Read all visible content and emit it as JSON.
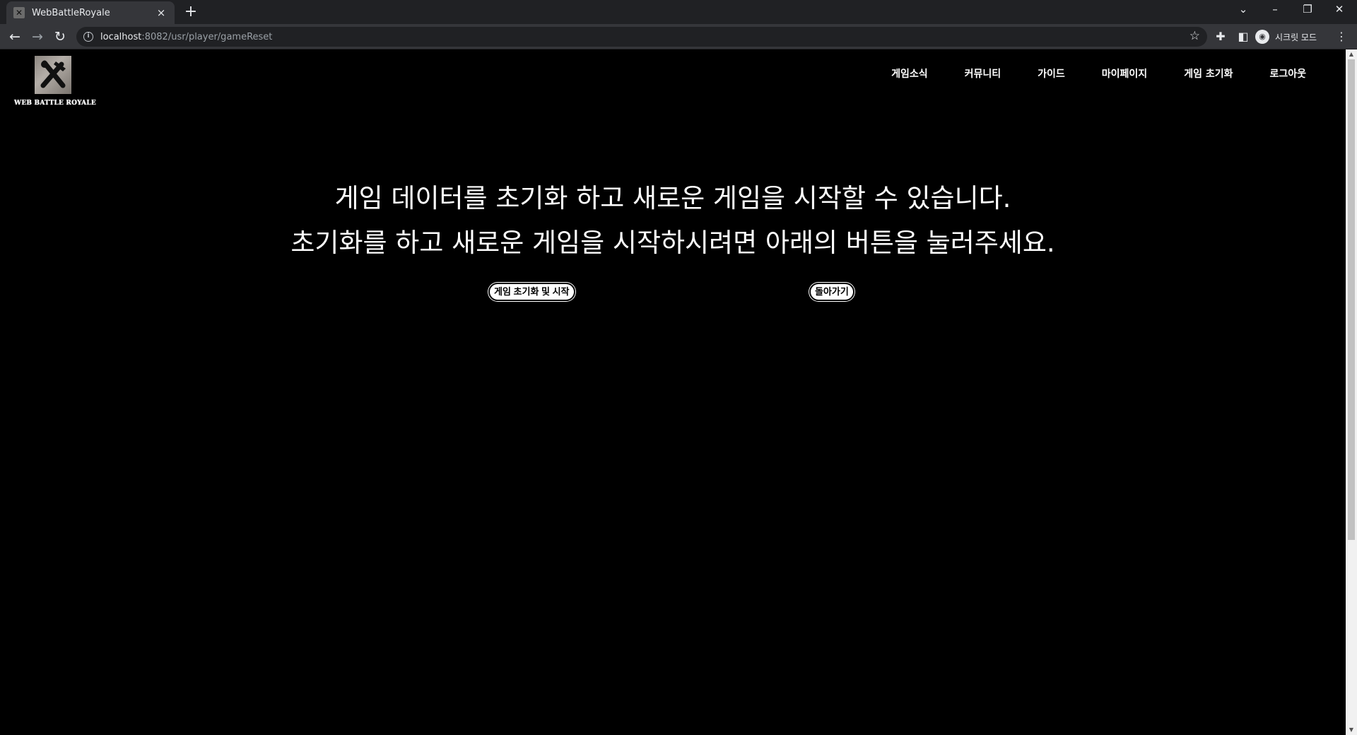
{
  "browser": {
    "tab_title": "WebBattleRoyale",
    "tab_close": "×",
    "new_tab": "+",
    "url_host": "localhost",
    "url_rest": ":8082/usr/player/gameReset",
    "profile_label": "시크릿 모드",
    "icons": [
      "back-icon",
      "forward-icon",
      "reload-icon",
      "info-icon",
      "star-icon",
      "extensions-icon",
      "side-panel-icon",
      "incognito-icon",
      "menu-icon"
    ]
  },
  "header": {
    "logo_text": "WEB BATTLE ROYALE",
    "nav": [
      {
        "label": "게임소식"
      },
      {
        "label": "커뮤니티"
      },
      {
        "label": "가이드"
      },
      {
        "label": "마이페이지"
      },
      {
        "label": "게임 초기화"
      },
      {
        "label": "로그아웃"
      }
    ]
  },
  "main": {
    "line1": "게임 데이터를 초기화 하고 새로운 게임을 시작할 수 있습니다.",
    "line2": "초기화를 하고 새로운 게임을 시작하시려면 아래의 버튼을 눌러주세요.",
    "reset_button": "게임 초기화 및 시작",
    "back_button": "돌아가기"
  }
}
